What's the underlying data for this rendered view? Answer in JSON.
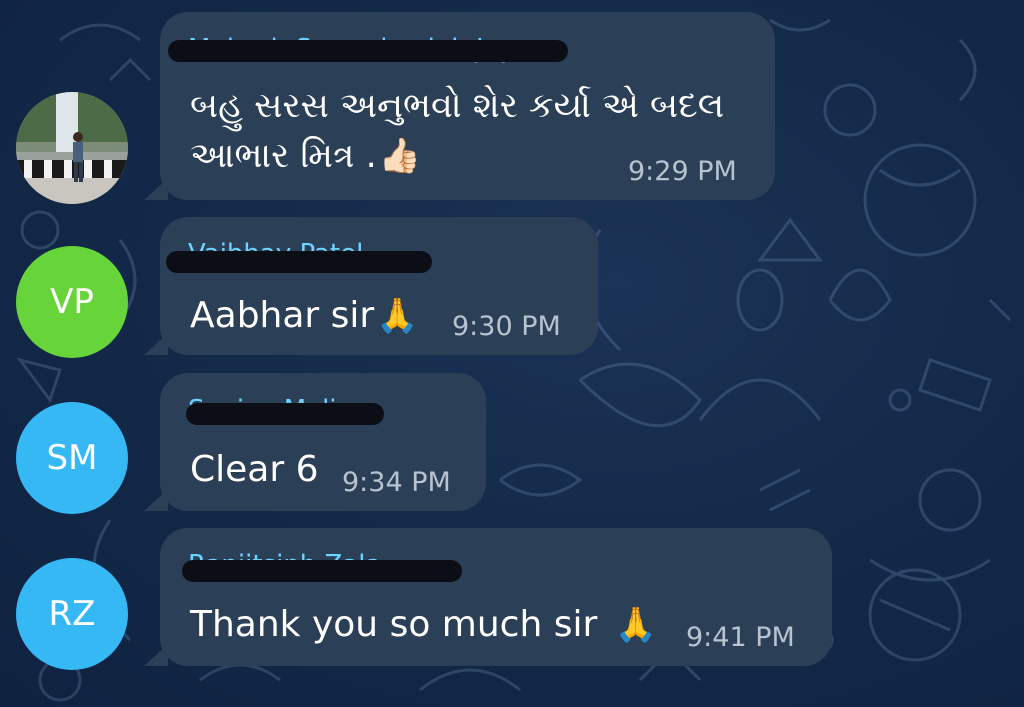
{
  "messages": [
    {
      "avatar": {
        "type": "photo",
        "label": ""
      },
      "sender": "Mukesh Surendrasinh Jay",
      "text_line1": "બહુ સરસ અનુભવો શેર કર્યા એ બદલ",
      "text_line2": "આભાર મિત્ર .",
      "emoji": "👍🏻",
      "time": "9:29 PM"
    },
    {
      "avatar": {
        "type": "initials",
        "label": "VP",
        "color": "#67d43a"
      },
      "sender": "Vaibhav Patel",
      "text": "Aabhar sir",
      "emoji": "🙏",
      "time": "9:30 PM"
    },
    {
      "avatar": {
        "type": "initials",
        "label": "SM",
        "color": "#36b8f5"
      },
      "sender": "Sanjay Mali",
      "text": "Clear 6",
      "time": "9:34 PM"
    },
    {
      "avatar": {
        "type": "initials",
        "label": "RZ",
        "color": "#36b8f5"
      },
      "sender": "Ranjitsinh Zala",
      "text": "Thank you so much sir",
      "emoji": "🙏",
      "time": "9:41 PM"
    }
  ],
  "colors": {
    "background": "#142a4a",
    "bubble": "#2b3f56",
    "sender_name": "#6fd3ff",
    "timestamp": "#b8c3d0",
    "redaction": "#0b0f15"
  }
}
